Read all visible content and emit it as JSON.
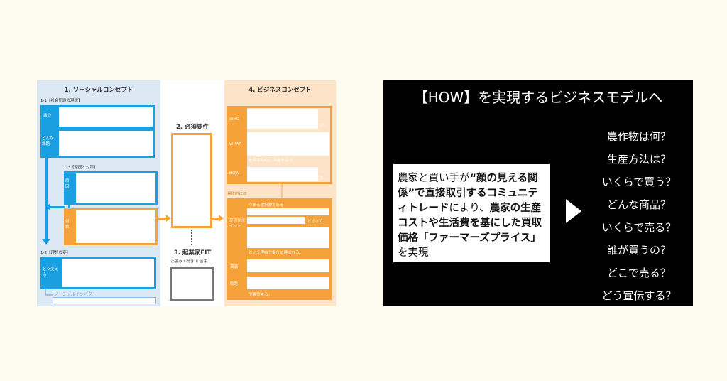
{
  "framework": {
    "col1_title": "1. ソーシャルコンセプト",
    "s11_label": "1-1【社会問題の現状】",
    "who_label": "誰の",
    "what_trouble_label": "どんな課題",
    "s13_label": "1-3【原因と対策】",
    "cause_label": "原因",
    "measure_label": "対策",
    "s12_label": "1-2【理想の姿】",
    "change_label": "どう変える",
    "impact_label": "ソーシャルインパクト",
    "col2_title": "2. 必須要件",
    "col3_title": "3. 起業家FIT",
    "fit_legend": "○強み・好き ✕ 苦手",
    "col4_title": "4. ビジネスコンセプト",
    "biz_who": "WHO",
    "biz_what": "WHAT",
    "biz_how": "HOW",
    "suffix_ga": "が、",
    "what_note": "を得るために お金を払う",
    "suffix_desu": "です。",
    "concrete_label": "具体的には",
    "current_choice": "今ある選択肢である",
    "compare": "と比べて",
    "diff_point": "差別化ポイント",
    "reason": "という理由で優位に選ばれる。",
    "resource_label": "資源",
    "channel_label": "販路",
    "sell_note": "で販売する。"
  },
  "slide": {
    "title": "【HOW】を実現するビジネスモデルへ",
    "desc": [
      {
        "t": "農家と買い手が",
        "b": false
      },
      {
        "t": "“顔の見える関係”で直接取引するコミュニティトレード",
        "b": true
      },
      {
        "t": "により、",
        "b": false
      },
      {
        "t": "農家の生産コストや生活費を基にした買取価格「ファーマーズプライス」",
        "b": true
      },
      {
        "t": "を実現",
        "b": false
      }
    ],
    "questions": [
      "農作物は何？",
      "生産方法は？",
      "いくらで買う？",
      "どんな商品？",
      "いくらで売る？",
      "誰が買うの？",
      "どこで売る？",
      "どう宣伝する？"
    ]
  },
  "colors": {
    "background": "#fefcf0",
    "blue": "#1aa0e0",
    "orange": "#f5a23a",
    "slide_bg": "#000000"
  }
}
